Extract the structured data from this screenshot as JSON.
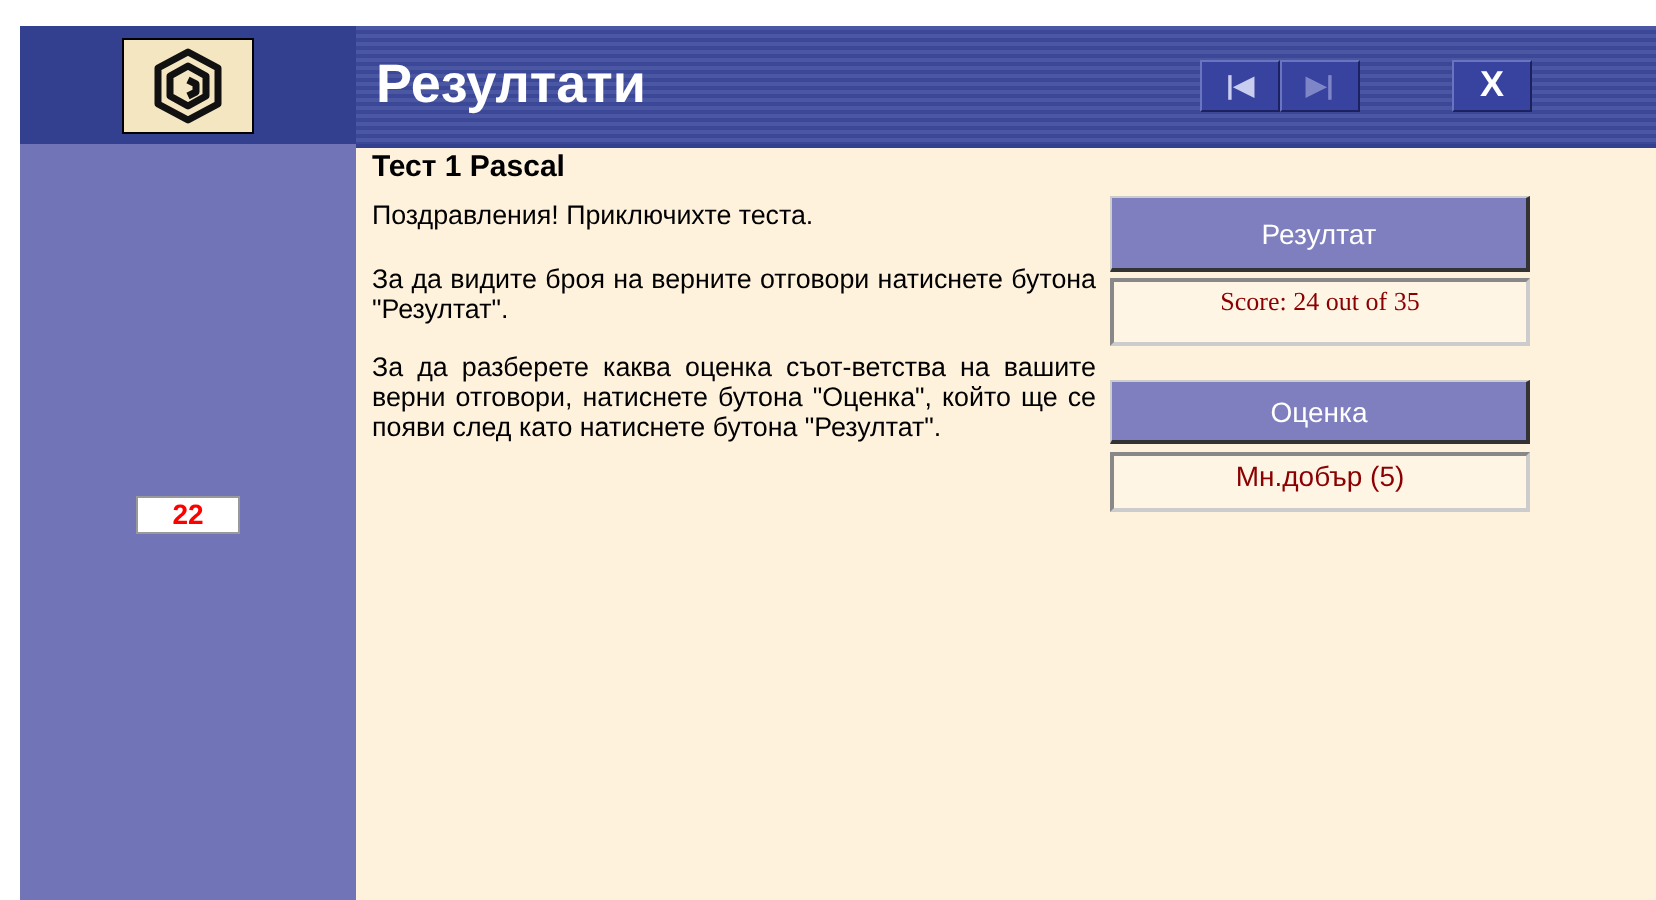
{
  "header": {
    "title": "Резултати",
    "nav_buttons": [
      {
        "label": "|◀",
        "kind": "first"
      },
      {
        "label": "▶|",
        "kind": "last"
      }
    ],
    "close_button": "X"
  },
  "sidebar": {
    "counter": "22"
  },
  "content": {
    "title": "Тест 1 Pascal",
    "paragraphs": [
      "Поздравления! Приключихте теста.",
      "За да видите броя на верните отговори натиснете бутона \"Резултат\".",
      "За да разберете каква оценка съот-ветства на вашите верни отговори, натиснете бутона \"Оценка\", който ще се появи след като натиснете бутона \"Резултат\"."
    ],
    "result_button": "Резултат",
    "score": "Score: 24 out of 35",
    "grade_button": "Оценка",
    "grade": "Мн.добър (5)"
  }
}
